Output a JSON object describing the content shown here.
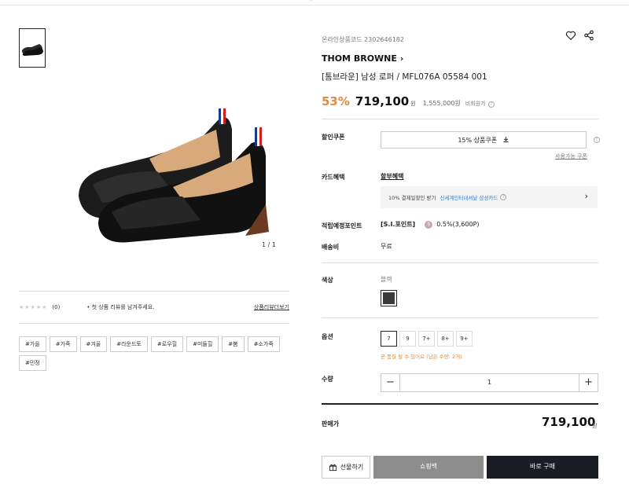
{
  "gallery": {
    "counter": "1 / 1"
  },
  "reviews": {
    "stars": "★★★★★",
    "count": "(0)",
    "note": "• 첫 상품 리뷰를 남겨주세요.",
    "link": "상품리뷰더보기"
  },
  "tags": [
    "#가을",
    "#가죽",
    "#겨울",
    "#라운드토",
    "#로우힐",
    "#미들힐",
    "#봄",
    "#소가죽",
    "#민정"
  ],
  "product": {
    "code": "온라인상품코드 2302646182",
    "brand": "THOM BROWNE",
    "brand_arrow": "›",
    "title": "[톰브라운] 남성 로퍼 / MFL076A 05584 001",
    "discount": "53%",
    "price": "719,100",
    "won": "원",
    "original_price": "1,555,000원",
    "original_label": "비회원가"
  },
  "benefits": {
    "coupon_label": "할인쿠폰",
    "coupon_button": "15% 상품쿠폰",
    "coupon_link": "사용가능 쿠폰",
    "card_label": "카드혜택",
    "card_link": "할부혜택",
    "card_text": "10% 결제일할인 받기",
    "card_highlight": "신세계인터내셔날 삼성카드",
    "points_label": "적립예정포인트",
    "points_brand": "[S.I.포인트]",
    "points_coin": "S",
    "points_value": "0.5%(3,600P)",
    "shipping_label": "배송비",
    "shipping_value": "무료"
  },
  "options": {
    "color_label": "색상",
    "color_name": "블랙",
    "swatch_color": "#3a3a3a",
    "option_label": "옵션",
    "sizes": [
      "7",
      "9",
      "7+",
      "8+",
      "9+"
    ],
    "selected_size": "7",
    "stock_note": "곧 품절 될 수 있어요 (남은 수량: 2개)",
    "qty_label": "수량",
    "qty_minus": "−",
    "qty_plus": "+",
    "qty_value": "1"
  },
  "total": {
    "label": "판매가",
    "price": "719,100",
    "won": "원"
  },
  "actions": {
    "gift": "선물하기",
    "bag": "쇼핑백",
    "buy": "바로 구매"
  },
  "colors": {
    "accent": "#e08a3c",
    "buy_bg": "#1a1d24",
    "bag_bg": "#8d8d8d",
    "link_blue": "#2a7bd4"
  }
}
